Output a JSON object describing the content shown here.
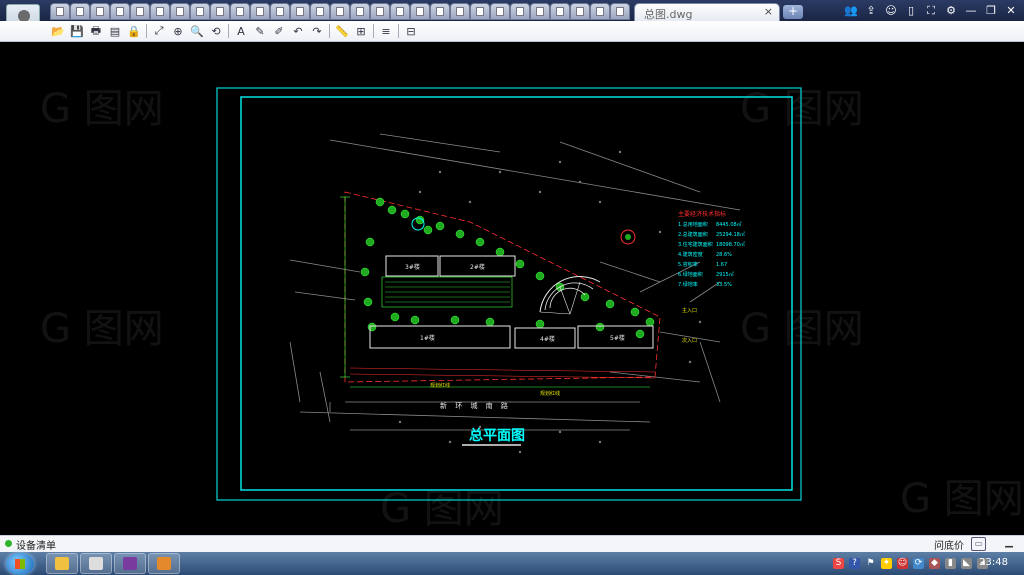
{
  "window": {
    "active_tab_label": "总图.dwg",
    "close_tab_glyph": "×",
    "new_tab_glyph": "+",
    "file_tab_count": 29,
    "controls": [
      "users-icon",
      "share-icon",
      "chat-icon",
      "mobile-icon",
      "fullscreen-icon",
      "settings-icon",
      "minimize-icon",
      "restore-icon",
      "close-icon"
    ],
    "control_glyphs": [
      "👥",
      "⇪",
      "☺",
      "▯",
      "⛶",
      "⚙",
      "—",
      "❐",
      "✕"
    ]
  },
  "toolbar": {
    "buttons": [
      {
        "name": "open-icon",
        "glyph": "📂"
      },
      {
        "name": "save-icon",
        "glyph": "💾"
      },
      {
        "name": "print-icon",
        "glyph": "🖶"
      },
      {
        "name": "export-pdf-icon",
        "glyph": "▤"
      },
      {
        "name": "lock-icon",
        "glyph": "🔒"
      },
      {
        "name": "sep"
      },
      {
        "name": "zoom-extents-icon",
        "glyph": "⤢"
      },
      {
        "name": "zoom-window-icon",
        "glyph": "⊕"
      },
      {
        "name": "zoom-realtime-icon",
        "glyph": "🔍"
      },
      {
        "name": "zoom-previous-icon",
        "glyph": "⟲"
      },
      {
        "name": "sep"
      },
      {
        "name": "text-icon",
        "glyph": "A"
      },
      {
        "name": "pen-icon",
        "glyph": "✎"
      },
      {
        "name": "eraser-icon",
        "glyph": "✐"
      },
      {
        "name": "undo-icon",
        "glyph": "↶"
      },
      {
        "name": "redo-icon",
        "glyph": "↷"
      },
      {
        "name": "sep"
      },
      {
        "name": "measure-icon",
        "glyph": "📏"
      },
      {
        "name": "dimension-icon",
        "glyph": "⊞"
      },
      {
        "name": "sep"
      },
      {
        "name": "layers-icon",
        "glyph": "≡"
      },
      {
        "name": "sep"
      },
      {
        "name": "properties-icon",
        "glyph": "⊟"
      }
    ]
  },
  "drawing": {
    "title": "总平面图",
    "road_label": "新 环 城 南 路",
    "building_labels": [
      "3#楼",
      "2#楼",
      "1#楼",
      "4#楼",
      "5#楼"
    ],
    "table_title": "主要经济技术指标",
    "table_rows": [
      [
        "1.总用地面积",
        "8445.08㎡"
      ],
      [
        "2.总建筑面积",
        "25294.18㎡"
      ],
      [
        "3.住宅建筑面积",
        "18098.70㎡"
      ],
      [
        "4.建筑密度",
        "28.6%"
      ],
      [
        "5.容积率",
        "1.67"
      ],
      [
        "6.绿地面积",
        "2915㎡"
      ],
      [
        "7.绿地率",
        "33.5%"
      ]
    ],
    "side_label_left": "规划红线",
    "side_label_right": "规划红线",
    "entrance_labels": [
      "主入口",
      "次入口"
    ],
    "colors": {
      "frame": "#00d5d5",
      "green": "#3cff3c",
      "yellow": "#e6e600",
      "red": "#ff3030",
      "white": "#e8e8e8",
      "cyan": "#00ffff",
      "gray": "#9a9a9a"
    }
  },
  "statusbar": {
    "text": "设备清单",
    "help": "问底价",
    "chat_glyph": "▭",
    "collapse_glyph": "▁"
  },
  "taskbar": {
    "clock": "23:48",
    "apps": [
      {
        "name": "explorer-icon",
        "color": "#f0c040"
      },
      {
        "name": "contact-icon",
        "color": "#dddddd"
      },
      {
        "name": "books-icon",
        "color": "#7a3b9e"
      },
      {
        "name": "cad-viewer-icon",
        "color": "#e58a2a"
      }
    ],
    "tray": [
      {
        "name": "sougou-icon",
        "glyph": "S",
        "color": "#e44"
      },
      {
        "name": "help-tray-icon",
        "glyph": "?",
        "color": "#35a"
      },
      {
        "name": "flag-icon",
        "glyph": "⚑",
        "color": "#fff0"
      },
      {
        "name": "qq-icon",
        "glyph": "✦",
        "color": "#fc0"
      },
      {
        "name": "user-tray-icon",
        "glyph": "☺",
        "color": "#c33"
      },
      {
        "name": "sync-icon",
        "glyph": "⟳",
        "color": "#48c"
      },
      {
        "name": "game-icon",
        "glyph": "◆",
        "color": "#a55"
      },
      {
        "name": "battery-icon",
        "glyph": "▮",
        "color": "#888"
      },
      {
        "name": "network-icon",
        "glyph": "◣",
        "color": "#888"
      },
      {
        "name": "volume-icon",
        "glyph": "◂",
        "color": "#888"
      }
    ]
  }
}
